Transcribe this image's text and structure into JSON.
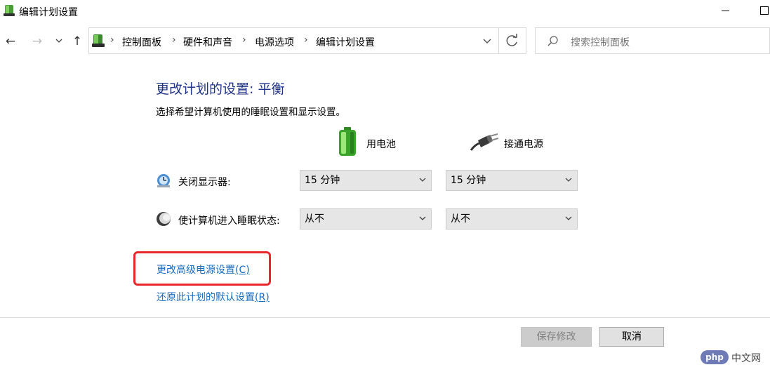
{
  "window": {
    "title": "编辑计划设置",
    "icon": "power-options-icon"
  },
  "nav": {
    "back_icon": "arrow-left-icon",
    "forward_icon": "arrow-right-icon",
    "recent_icon": "chevron-down-icon",
    "up_icon": "arrow-up-icon",
    "back": "←",
    "forward": "→",
    "recent": "⌄",
    "up": "↑"
  },
  "address": {
    "crumbs": [
      "控制面板",
      "硬件和声音",
      "电源选项",
      "编辑计划设置"
    ],
    "separator": "›"
  },
  "search": {
    "placeholder": "搜索控制面板"
  },
  "main": {
    "heading": "更改计划的设置: 平衡",
    "subtitle": "选择希望计算机使用的睡眠设置和显示设置。",
    "columns": {
      "battery": "用电池",
      "plugged_in": "接通电源"
    },
    "rows": [
      {
        "label": "关闭显示器:",
        "icon": "monitor-icon",
        "battery_value": "15 分钟",
        "plugged_value": "15 分钟"
      },
      {
        "label": "使计算机进入睡眠状态:",
        "icon": "moon-icon",
        "battery_value": "从不",
        "plugged_value": "从不"
      }
    ],
    "links": {
      "advanced": "更改高级电源设置",
      "advanced_key": "(C)",
      "restore": "还原此计划的默认设置",
      "restore_key": "(R)"
    }
  },
  "buttons": {
    "save": "保存修改",
    "cancel": "取消"
  },
  "watermark": {
    "badge": "php",
    "text": "中文网"
  },
  "colors": {
    "heading": "#1e3287",
    "link": "#1a6cbf",
    "highlight": "#e8262c",
    "dropdown_bg": "#e6e6e6"
  }
}
